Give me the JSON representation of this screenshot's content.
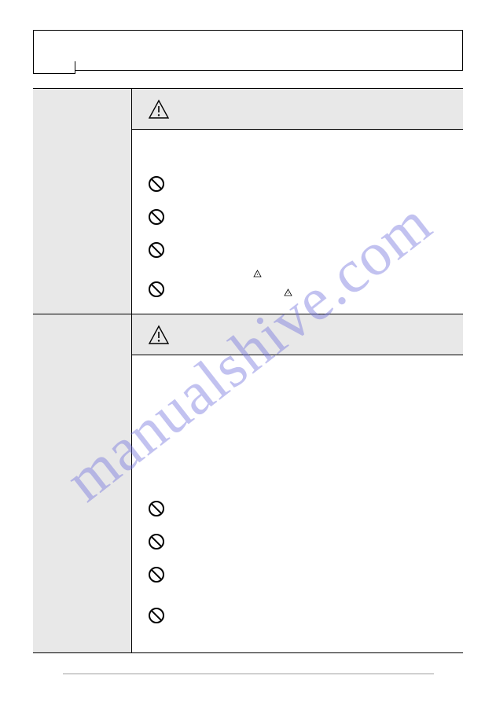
{
  "watermark": "manualshive.com",
  "icons": {
    "warning": "warning-triangle",
    "prohibit": "prohibition-circle",
    "miniwarn": "small-warning-triangle"
  },
  "section1": {
    "items": [
      "",
      "",
      "",
      ""
    ]
  },
  "section2": {
    "items": [
      "",
      "",
      "",
      ""
    ]
  }
}
